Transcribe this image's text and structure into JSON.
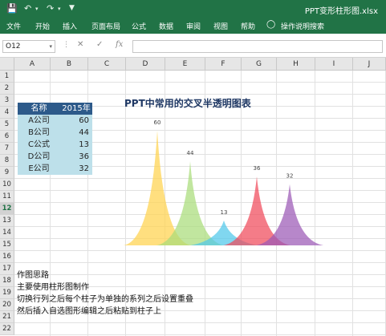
{
  "window": {
    "file_title": "PPT变形柱形图.xlsx",
    "save_icon": "save-icon",
    "undo_icon": "undo-icon",
    "redo_icon": "redo-icon"
  },
  "ribbon": {
    "tabs": [
      "文件",
      "开始",
      "插入",
      "页面布局",
      "公式",
      "数据",
      "审阅",
      "视图",
      "帮助"
    ],
    "tellme": "操作说明搜索",
    "tellme_icon": "lightbulb-icon"
  },
  "formula_bar": {
    "name_box": "O12",
    "cancel_icon": "close-icon",
    "enter_icon": "check-icon",
    "fx_label": "fx",
    "content": ""
  },
  "columns": [
    "A",
    "B",
    "C",
    "D",
    "E",
    "F",
    "G",
    "H",
    "I",
    "J"
  ],
  "rows": [
    "1",
    "2",
    "3",
    "4",
    "5",
    "6",
    "7",
    "8",
    "9",
    "10",
    "11",
    "12",
    "13",
    "14",
    "15",
    "16",
    "17",
    "18",
    "19",
    "20",
    "21",
    "22"
  ],
  "selected_row": "12",
  "table": {
    "header": [
      "名称",
      "2015年"
    ],
    "rows": [
      {
        "name": "A公司",
        "value": "60"
      },
      {
        "name": "B公司",
        "value": "44"
      },
      {
        "name": "C公式",
        "value": "13"
      },
      {
        "name": "D公司",
        "value": "36"
      },
      {
        "name": "E公司",
        "value": "32"
      }
    ]
  },
  "notes": [
    "作图思路",
    "主要使用柱形图制作",
    "切换行列之后每个柱子为单独的系列之后设置重叠",
    "然后插入自选图形编辑之后粘贴到柱子上"
  ],
  "chart_data": {
    "type": "bar",
    "title": "PPT中常用的交叉半透明图表",
    "categories": [
      "A公司",
      "B公司",
      "C公式",
      "D公司",
      "E公司"
    ],
    "values": [
      60,
      44,
      13,
      36,
      32
    ],
    "colors": [
      "#ffd24d",
      "#a9dc7a",
      "#4fc8ea",
      "#f04a5a",
      "#9b59b6"
    ],
    "ylim": [
      0,
      60
    ],
    "grid": false,
    "legend": "none"
  }
}
